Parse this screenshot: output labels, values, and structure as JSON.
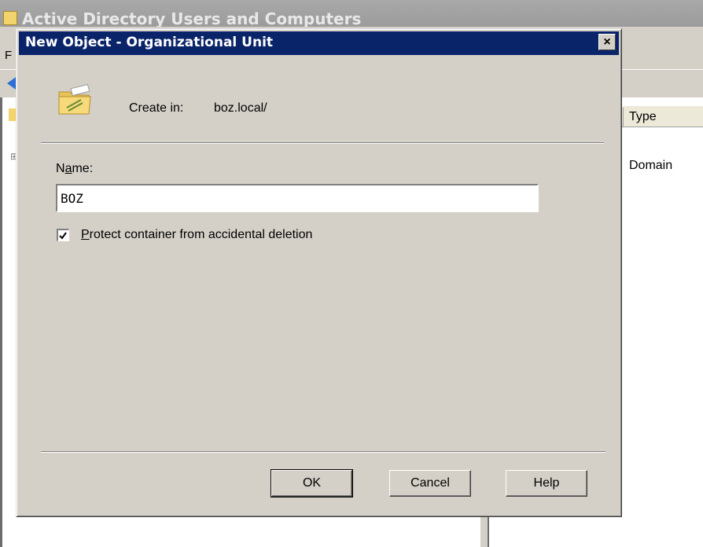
{
  "background_window": {
    "title": "Active Directory Users and Computers",
    "menu_first_letter": "F",
    "right_pane": {
      "column_type": "Type",
      "row_type": "Domain"
    },
    "expander_glyph": "⊞"
  },
  "dialog": {
    "title": "New Object - Organizational Unit",
    "close_glyph": "×",
    "create_in_label": "Create in:",
    "create_in_value": "boz.local/",
    "name_label_pre": "N",
    "name_label_accel": "a",
    "name_label_post": "me:",
    "name_value": "BOZ",
    "protect_checked": true,
    "protect_label_accel": "P",
    "protect_label_rest": "rotect container from accidental deletion",
    "buttons": {
      "ok": "OK",
      "cancel": "Cancel",
      "help": "Help"
    }
  },
  "icons": [
    "folder-ou-icon",
    "close-icon",
    "back-arrow-icon",
    "checkmark-icon"
  ],
  "colors": {
    "titlebar": "#0a246a",
    "face": "#d4d0c8",
    "folder": "#f3d36b"
  }
}
